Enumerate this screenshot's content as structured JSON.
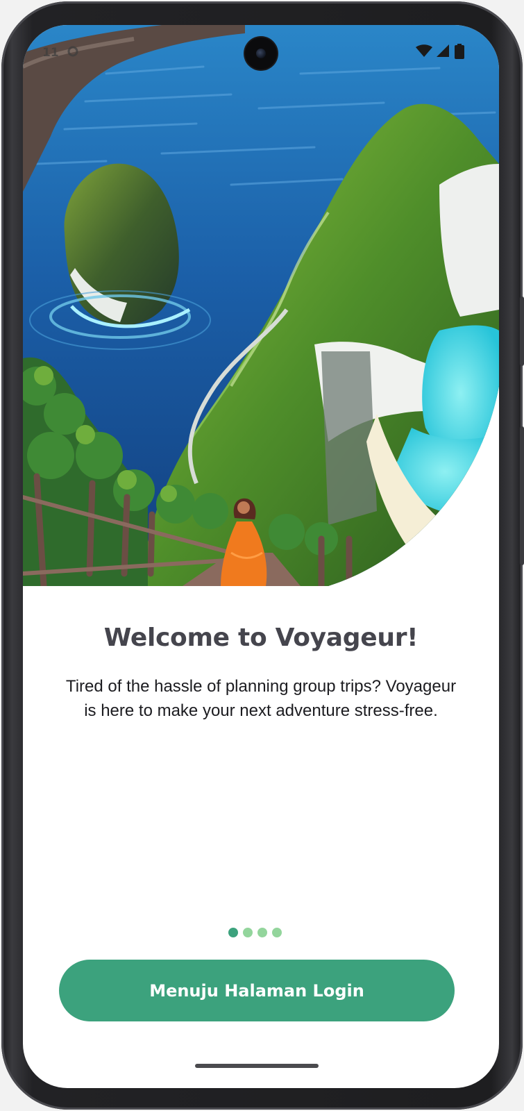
{
  "welcome": {
    "title": "Welcome to Voyageur!",
    "body": "Tired of the hassle of planning group trips? Voyageur is here to make your next adventure stress-free."
  },
  "pager": {
    "active_index": 0,
    "count": 4,
    "active_color": "#3ca27d",
    "inactive_color": "#93d59c"
  },
  "cta": {
    "label": "Menuju Halaman Login",
    "color": "#3ca27d"
  },
  "status_bar": {
    "time": "11",
    "icons": [
      "wifi-icon",
      "signal-icon",
      "battery-icon"
    ]
  }
}
